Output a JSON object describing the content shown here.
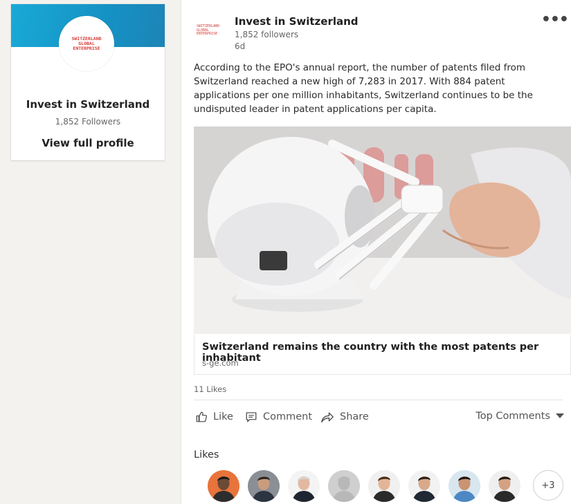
{
  "profile": {
    "logo_text": [
      "SWITZERLAND",
      "GLOBAL",
      "ENTERPRISE"
    ],
    "name": "Invest in Switzerland",
    "followers": "1,852 Followers",
    "view_profile_label": "View full profile",
    "banner_color": "#19a9d6"
  },
  "post": {
    "author": "Invest in Switzerland",
    "followers": "1,852 followers",
    "time": "6d",
    "more_icon": "ellipsis-icon",
    "text": "According to the EPO's annual report, the number of patents filed from Switzerland reached a new high of 7,283 in 2017. With 884 patent applications per one million inhabitants, Switzerland continues to be the undisputed leader in patent applications per capita.",
    "image_description_icon": "robot-arm-photo",
    "article_title": "Switzerland remains the country with the most patents per inhabitant",
    "article_source": "s-ge.com",
    "likes_count": "11 Likes"
  },
  "actions": {
    "like": {
      "label": "Like",
      "icon": "thumbs-up-icon"
    },
    "comment": {
      "label": "Comment",
      "icon": "comment-icon"
    },
    "share": {
      "label": "Share",
      "icon": "share-arrow-icon"
    },
    "sort": {
      "label": "Top Comments",
      "icon": "caret-down-icon"
    }
  },
  "likes": {
    "heading": "Likes",
    "more": "+3",
    "avatars": [
      {
        "bg": "#e8733b",
        "skin": "#6b4a36",
        "hair": "#1a1a1a",
        "suit": "#2d2d2d"
      },
      {
        "bg": "#8a8f96",
        "skin": "#c99c7e",
        "hair": "#2a2522",
        "suit": "#2b3440"
      },
      {
        "bg": "#f4f4f4",
        "skin": "#e2b9a0",
        "hair": "#d7d2cd",
        "suit": "#1f2530"
      },
      {
        "bg": "#cfcfcf",
        "skin": "#b8b8b8",
        "hair": "#b8b8b8",
        "suit": "#b8b8b8"
      },
      {
        "bg": "#f0f0f0",
        "skin": "#e3b498",
        "hair": "#4a2e1d",
        "suit": "#2a2a2a"
      },
      {
        "bg": "#f2f2f2",
        "skin": "#d8a98a",
        "hair": "#2b2118",
        "suit": "#1f2833"
      },
      {
        "bg": "#d8e6ef",
        "skin": "#c89472",
        "hair": "#1d1612",
        "suit": "#4d88c4"
      },
      {
        "bg": "#efefef",
        "skin": "#d4a182",
        "hair": "#231a14",
        "suit": "#2a2a2a"
      }
    ]
  }
}
